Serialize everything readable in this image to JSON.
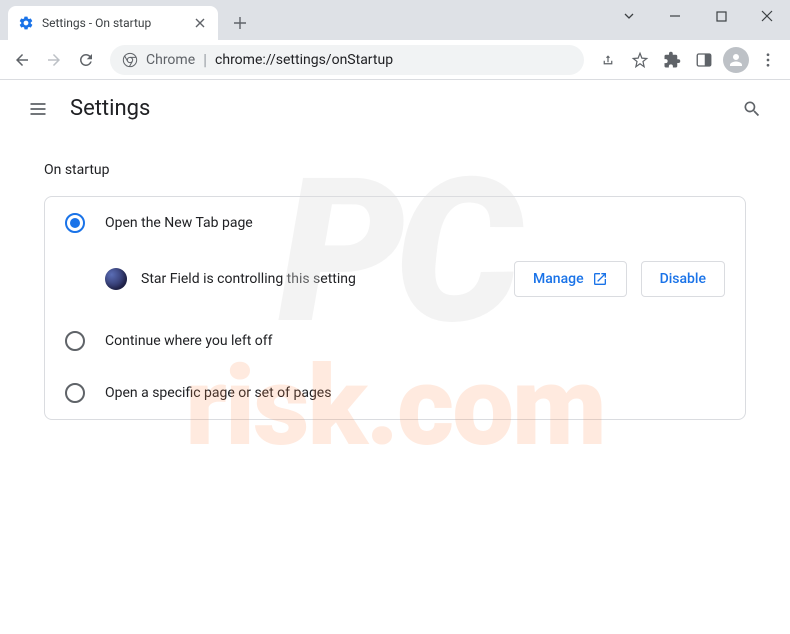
{
  "tab": {
    "title": "Settings - On startup"
  },
  "omnibox": {
    "prefix": "Chrome",
    "url": "chrome://settings/onStartup"
  },
  "header": {
    "title": "Settings"
  },
  "section": {
    "title": "On startup"
  },
  "options": {
    "opt1": "Open the New Tab page",
    "opt2": "Continue where you left off",
    "opt3": "Open a specific page or set of pages"
  },
  "controlled": {
    "text": "Star Field is controlling this setting",
    "manage": "Manage",
    "disable": "Disable"
  },
  "watermark": {
    "line1": "PC",
    "line2": "risk.com"
  }
}
